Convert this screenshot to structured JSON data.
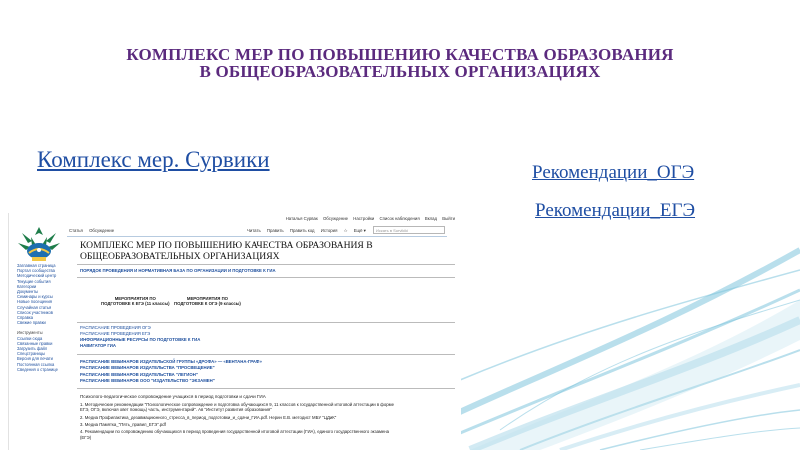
{
  "slide": {
    "title_line1": "КОМПЛЕКС МЕР ПО ПОВЫШЕНИЮ КАЧЕСТВА ОБРАЗОВАНИЯ",
    "title_line2": "В ОБЩЕОБРАЗОВАТЕЛЬНЫХ ОРГАНИЗАЦИЯХ",
    "link_main": "Комплекс мер. Сурвики",
    "link_oge": "Рекомендации_ОГЭ",
    "link_ege": "Рекомендации_ЕГЭ",
    "colors": {
      "title": "#5b2a7e",
      "link": "#1f4ea3",
      "waves": "#7fc4dd"
    }
  },
  "wiki": {
    "top_links": [
      "Наталья Сурвак",
      "Обсуждение",
      "Настройки",
      "Список наблюдения",
      "Вклад",
      "Выйти"
    ],
    "tabs_left": [
      "Статья",
      "Обсуждение"
    ],
    "tabs_right": [
      "Читать",
      "Править",
      "Править код",
      "История",
      "☆",
      "Ещё ▾"
    ],
    "search_placeholder": "Искать в Survikiki",
    "sidebar_group1": [
      "Заглавная страница",
      "Портал сообщества",
      "Методический центр",
      "Текущие события",
      "Категории",
      "Документы",
      "Семинары и курсы",
      "Новые посещения",
      "Случайная статья",
      "Список участников",
      "Справка",
      "Свежие правки"
    ],
    "sidebar_head": "Инструменты",
    "sidebar_group2": [
      "Ссылки сюда",
      "Связанные правки",
      "Загрузить файл",
      "Спецстраницы",
      "Версия для печати",
      "Постоянная ссылка",
      "Сведения о странице"
    ],
    "heading_line1": "КОМПЛЕКС МЕР ПО ПОВЫШЕНИЮ КАЧЕСТВА ОБРАЗОВАНИЯ В",
    "heading_line2": "ОБЩЕОБРАЗОВАТЕЛЬНЫХ ОРГАНИЗАЦИЯХ",
    "nav_row": "ПОРЯДОК ПРОВЕДЕНИЯ И НОРМАТИВНАЯ БАЗА ПО ОРГАНИЗАЦИИ И ПОДГОТОВКЕ К ГИА",
    "col1_line1": "МЕРОПРИЯТИЯ ПО",
    "col1_line2": "ПОДГОТОВКЕ К ЕГЭ (11 классы)",
    "col2_line1": "МЕРОПРИЯТИЯ ПО",
    "col2_line2": "ПОДГОТОВКЕ К ОГЭ (9 классы)",
    "links_a": [
      "РАСПИСАНИЕ ПРОВЕДЕНИЯ ОГЭ",
      "РАСПИСАНИЕ ПРОВЕДЕНИЯ ЕГЭ"
    ],
    "links_a_bold": [
      "ИНФОРМАЦИОННЫЕ РЕСУРСЫ ПО ПОДГОТОВКЕ К ГИА",
      "НАВИГАТОР ГИА"
    ],
    "links_b": [
      "РАСПИСАНИЕ ВЕБИНАРОВ ИЗДАТЕЛЬСКОЙ ГРУППЫ «ДРОФА» — «ВЕНТАНА-ГРАФ»",
      "РАСПИСАНИЕ ВЕБИНАРОВ ИЗДАТЕЛЬСТВА \"ПРОСВЕЩЕНИЕ\"",
      "РАСПИСАНИЕ ВЕБИНАРОВ ИЗДАТЕЛЬСТВА \"ЛЕГИОН\"",
      "РАСПИСАНИЕ ВЕБИНАРОВ ООО \"ИЗДАТЕЛЬСТВО \"ЭКЗАМЕН\""
    ],
    "psych_title": "Психолого-педагогическое сопровождение учащихся в период подготовки и сдачи ГИА",
    "psych_items": [
      "1. Методические рекомендации \"Психологическое сопровождение и подготовка обучающихся 9, 11 классов к государственной итоговой аттестации в форме",
      "ЕГЭ, ОГЭ, включая овет помощь) часть, инструментарий\". Ав \"Институт развития образования\"",
      "2. Медиа Профилактика_дезавмациюнного_стресса_в_период_подготовки_и_сдачи_ГИА.pdf. Нерин Е.В. методист МБУ \"ЦДиК\"",
      "3. Медиа Памятка_\"Пять_правил_ЕГЭ\".pdf",
      "4. Рекомендации по сопровождению обучающихся в период проведения государственной итоговой аттестации (ГИА), единого государственного экзамена",
      "(ЕГЭ)"
    ]
  }
}
